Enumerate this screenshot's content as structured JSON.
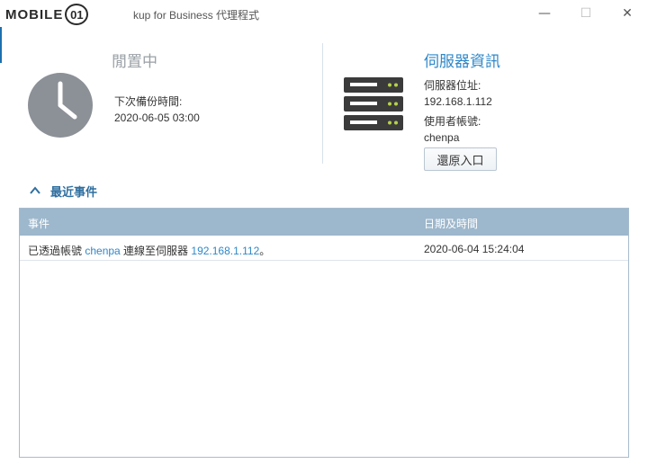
{
  "window": {
    "logo_text": "MOBILE",
    "logo_badge": "01",
    "title": "kup for Business 代理程式",
    "minimize": "—",
    "maximize": "☐",
    "close": "✕"
  },
  "status": {
    "title": "閒置中",
    "next_backup_label": "下次備份時間:",
    "next_backup_value": "2020-06-05 03:00"
  },
  "server": {
    "title": "伺服器資訊",
    "address_label": "伺服器位址:",
    "address_value": "192.168.1.112",
    "user_label": "使用者帳號:",
    "user_value": "chenpa",
    "restore_button": "還原入口"
  },
  "recent": {
    "title": "最近事件",
    "columns": [
      "事件",
      "日期及時間"
    ],
    "rows": [
      {
        "event_prefix": "已透過帳號 ",
        "event_user": "chenpa",
        "event_middle": " 連線至伺服器 ",
        "event_ip": "192.168.1.112",
        "event_suffix": "。",
        "datetime": "2020-06-04 15:24:04"
      }
    ]
  },
  "colors": {
    "accent": "#2f88c8",
    "header": "#9db7cc",
    "clock": "#8c9097",
    "server_icon": "#3b3b3b",
    "led": "#b7d24a"
  }
}
